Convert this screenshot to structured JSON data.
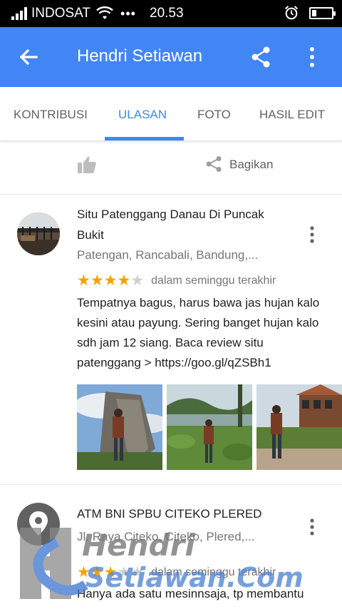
{
  "status_bar": {
    "carrier": "INDOSAT",
    "more": "•••",
    "time": "20.53"
  },
  "app_bar": {
    "title": "Hendri Setiawan"
  },
  "tabs": [
    {
      "label": "KONTRIBUSI",
      "active": false
    },
    {
      "label": "ULASAN",
      "active": true
    },
    {
      "label": "FOTO",
      "active": false
    },
    {
      "label": "HASIL EDIT",
      "active": false
    }
  ],
  "actions": {
    "share_label": "Bagikan"
  },
  "reviews": [
    {
      "place": "Situ Patenggang Danau Di Puncak Bukit",
      "address": "Patengan, Rancabali, Bandung,...",
      "rating": 4,
      "max_rating": 5,
      "time": "dalam seminggu terakhir",
      "text": "Tempatnya bagus,  harus bawa jas hujan kalo kesini atau payung. Sering banget hujan kalo sdh jam 12 siang. Baca review situ patenggang > https://goo.gl/qZSBh1",
      "photo_count": 3
    },
    {
      "place": "ATM BNI SPBU CITEKO PLERED",
      "address": "Jl. Raya Citeko, Citeko, Plered,...",
      "rating": 3,
      "max_rating": 5,
      "time": "dalam seminggu terakhir",
      "text": "Hanya ada satu mesinnsaja, tp membantu"
    }
  ],
  "watermark": {
    "line1": "Hendri",
    "line2": "Setiawan.Com"
  },
  "colors": {
    "primary": "#4285f4",
    "star": "#f4a100",
    "status_bar": "#000000"
  }
}
